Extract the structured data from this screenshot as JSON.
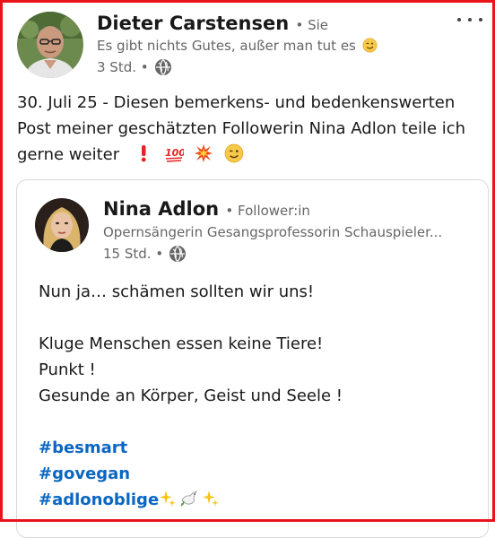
{
  "post": {
    "author": {
      "name": "Dieter Carstensen",
      "degree": "• Sie",
      "tagline": "Es gibt nichts Gutes, außer man tut es",
      "time": "3 Std. •"
    },
    "text_lines": [
      "30. Juli 25 - Diesen bemerkens- und bedenkenswerten",
      "Post meiner geschätzten Followerin Nina Adlon teile ich",
      "gerne weiter"
    ],
    "emoji_icons": [
      "exclamation-icon",
      "hundred-points-icon",
      "collision-icon",
      "winking-face-icon"
    ]
  },
  "shared": {
    "author": {
      "name": "Nina Adlon",
      "degree": "• Follower:in",
      "headline": "Opernsängerin Gesangsprofessorin Schauspieler...",
      "time": "15 Std. •"
    },
    "text": {
      "line1": "Nun ja… schämen sollten wir uns!",
      "line2": "Kluge Menschen essen keine Tiere!",
      "line3": "Punkt !",
      "line4": "Gesunde an Körper, Geist und Seele !"
    },
    "hashtags": [
      "#besmart",
      "#govegan",
      "#adlonoblige"
    ]
  },
  "colors": {
    "frame": "#e8141b",
    "link": "#0a66c2",
    "secondary_text": "#666666"
  }
}
